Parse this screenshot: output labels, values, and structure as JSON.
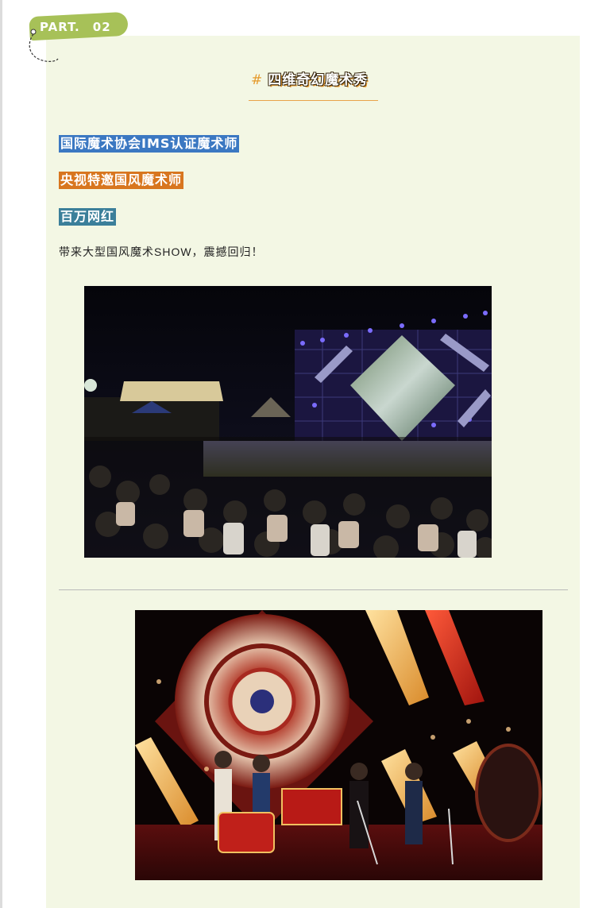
{
  "badge": {
    "label": "PART.",
    "number": "02"
  },
  "section": {
    "hash": "#",
    "title": "四维奇幻魔术秀"
  },
  "highlights": [
    {
      "text": "国际魔术协会IMS认证魔术师",
      "color": "#3b78c2"
    },
    {
      "text": "央视特邀国风魔术师",
      "color": "#d8761f"
    },
    {
      "text": "百万网红",
      "color": "#3b7f9a"
    }
  ],
  "body": {
    "text": "带来大型国风魔术SHOW，震撼回归！"
  },
  "photos": [
    {
      "name": "night-outdoor-magic-show-crowd"
    },
    {
      "name": "stage-performers-with-drums"
    }
  ],
  "colors": {
    "panel": "#f3f7e4",
    "tag": "#a7c158",
    "accent": "#e59a2b"
  }
}
